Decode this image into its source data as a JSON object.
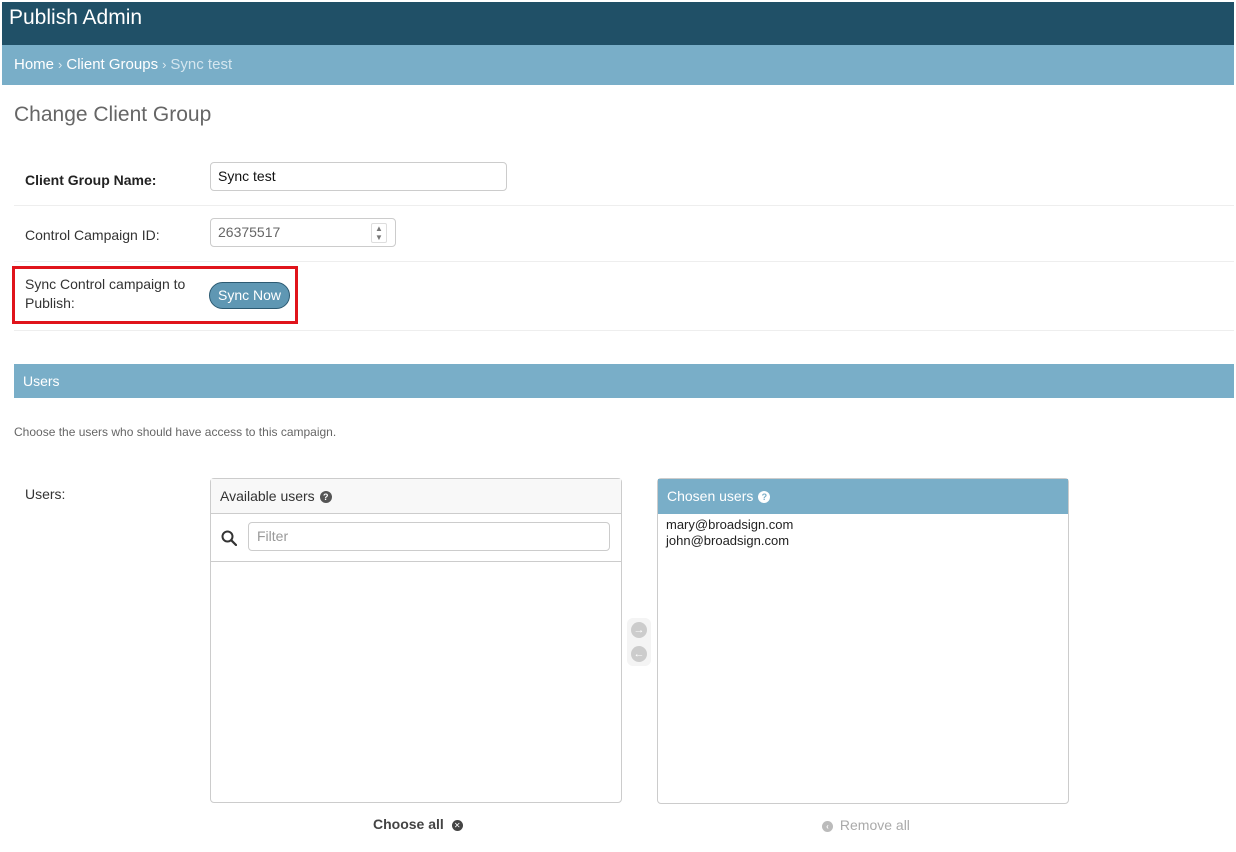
{
  "header": {
    "site_title": "Publish Admin"
  },
  "breadcrumbs": {
    "home": "Home",
    "section": "Client Groups",
    "current": "Sync test",
    "separator": "›"
  },
  "page_title": "Change Client Group",
  "fields": {
    "client_group_name": {
      "label": "Client Group Name:",
      "value": "Sync test"
    },
    "control_campaign_id": {
      "label": "Control Campaign ID:",
      "value": "26375517"
    },
    "sync": {
      "label": "Sync Control campaign to Publish:",
      "button_label": "Sync Now"
    }
  },
  "users_module": {
    "caption": "Users",
    "help_text": "Choose the users who should have access to this campaign.",
    "field_label": "Users:",
    "available": {
      "title": "Available users",
      "filter_placeholder": "Filter",
      "options": []
    },
    "chosen": {
      "title": "Chosen users",
      "options": [
        "mary@broadsign.com",
        "john@broadsign.com"
      ]
    },
    "choose_all": "Choose all",
    "remove_all": "Remove all"
  },
  "colors": {
    "header": "#205067",
    "breadcrumb_bar": "#79aec8",
    "highlight": "#e0141b",
    "button": "#5f97b3"
  },
  "icons": {
    "help": "question-circle-icon",
    "search": "search-icon",
    "add": "arrow-right-icon",
    "remove": "arrow-left-icon"
  }
}
